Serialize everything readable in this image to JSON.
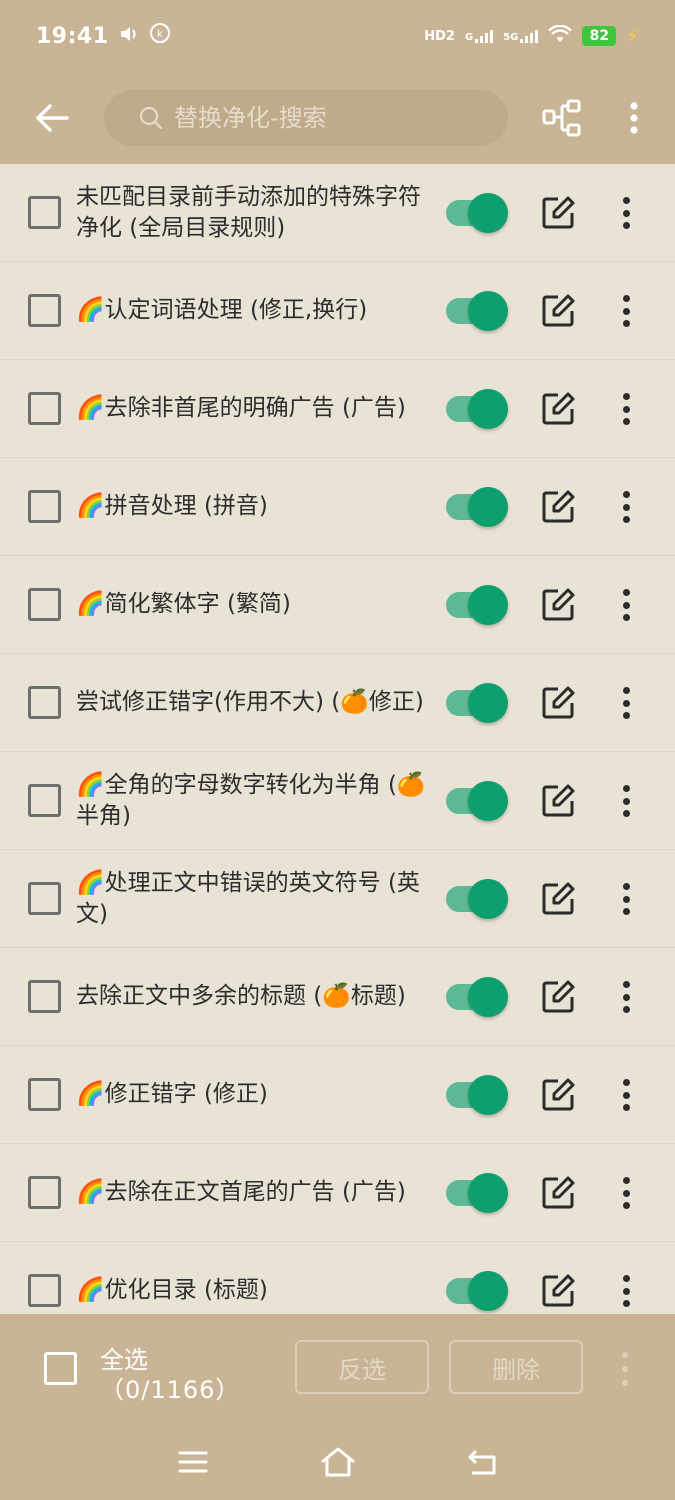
{
  "status_bar": {
    "time": "19:41",
    "battery": "82",
    "network_hd": "HD2",
    "network_g": "G",
    "network_5g": "5G"
  },
  "toolbar": {
    "search_placeholder": "替换净化-搜索"
  },
  "rules": [
    {
      "name": "未匹配目录前手动添加的特殊字符净化 (全局目录规则)",
      "enabled": true
    },
    {
      "name": "🌈认定词语处理 (修正,换行)",
      "enabled": true
    },
    {
      "name": "🌈去除非首尾的明确广告 (广告)",
      "enabled": true
    },
    {
      "name": "🌈拼音处理 (拼音)",
      "enabled": true
    },
    {
      "name": "🌈简化繁体字 (繁简)",
      "enabled": true
    },
    {
      "name": "尝试修正错字(作用不大) (🍊修正)",
      "enabled": true
    },
    {
      "name": "🌈全角的字母数字转化为半角 (🍊半角)",
      "enabled": true
    },
    {
      "name": "🌈处理正文中错误的英文符号 (英文)",
      "enabled": true
    },
    {
      "name": "去除正文中多余的标题 (🍊标题)",
      "enabled": true
    },
    {
      "name": "🌈修正错字 (修正)",
      "enabled": true
    },
    {
      "name": "🌈去除在正文首尾的广告 (广告)",
      "enabled": true
    },
    {
      "name": "🌈优化目录 (标题)",
      "enabled": true
    }
  ],
  "bottom_bar": {
    "select_all_label": "全选",
    "select_count": "（0/1166）",
    "invert_label": "反选",
    "delete_label": "删除"
  },
  "colors": {
    "bar": "#c9b595",
    "background": "#e9e3d6",
    "switch_on": "#0d9f6e"
  }
}
